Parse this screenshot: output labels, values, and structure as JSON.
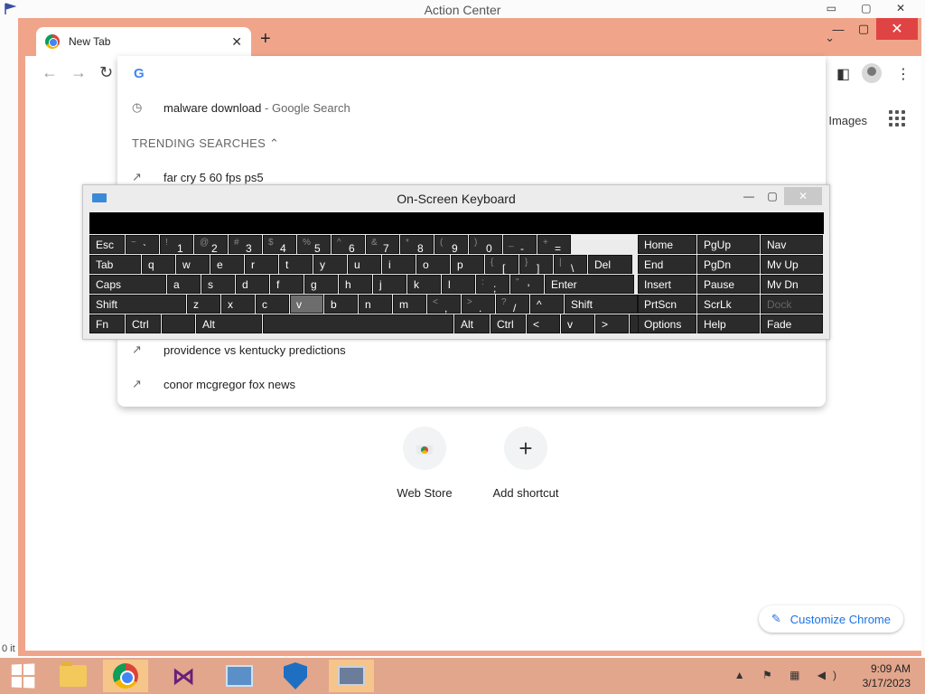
{
  "background_window": {
    "title": "Action Center",
    "left_fragment": "0 it"
  },
  "chrome": {
    "tab": {
      "title": "New Tab"
    },
    "new_tab_symbol": "+",
    "page": {
      "images_link": "Images",
      "shortcuts": [
        {
          "label": "Web Store",
          "icon": "webstore-icon"
        },
        {
          "label": "Add shortcut",
          "icon": "plus-icon"
        }
      ],
      "customize_label": "Customize Chrome"
    },
    "omnibox": {
      "history": [
        {
          "query": "malware download",
          "suffix": "- Google Search"
        }
      ],
      "trending_header": "TRENDING SEARCHES",
      "trending": [
        "far cry 5 60 fps ps5",
        "providence vs kentucky predictions",
        "conor mcgregor fox news"
      ]
    }
  },
  "osk": {
    "title": "On-Screen Keyboard",
    "rows": [
      [
        "Esc",
        "~ `",
        "! 1",
        "@ 2",
        "# 3",
        "$ 4",
        "% 5",
        "^ 6",
        "& 7",
        "* 8",
        "( 9",
        ") 0",
        "_ -",
        "+ ="
      ],
      [
        "Tab",
        "q",
        "w",
        "e",
        "r",
        "t",
        "y",
        "u",
        "i",
        "o",
        "p",
        "{ [",
        "} ]",
        "| \\",
        "Del"
      ],
      [
        "Caps",
        "a",
        "s",
        "d",
        "f",
        "g",
        "h",
        "j",
        "k",
        "l",
        ": ;",
        "\" '",
        "Enter"
      ],
      [
        "Shift",
        "z",
        "x",
        "c",
        "v",
        "b",
        "n",
        "m",
        "< ,",
        "> .",
        "? /",
        "^",
        "Shift"
      ],
      [
        "Fn",
        "Ctrl",
        "",
        "Alt",
        "",
        "Alt",
        "Ctrl",
        "<",
        "v",
        ">",
        ""
      ]
    ],
    "nav_keys": [
      [
        "Home",
        "PgUp",
        "Nav"
      ],
      [
        "End",
        "PgDn",
        "Mv Up"
      ],
      [
        "Insert",
        "Pause",
        "Mv Dn"
      ],
      [
        "PrtScn",
        "ScrLk",
        "Dock"
      ],
      [
        "Options",
        "Help",
        "Fade"
      ]
    ]
  },
  "taskbar": {
    "clock_time": "9:09 AM",
    "clock_date": "3/17/2023"
  }
}
